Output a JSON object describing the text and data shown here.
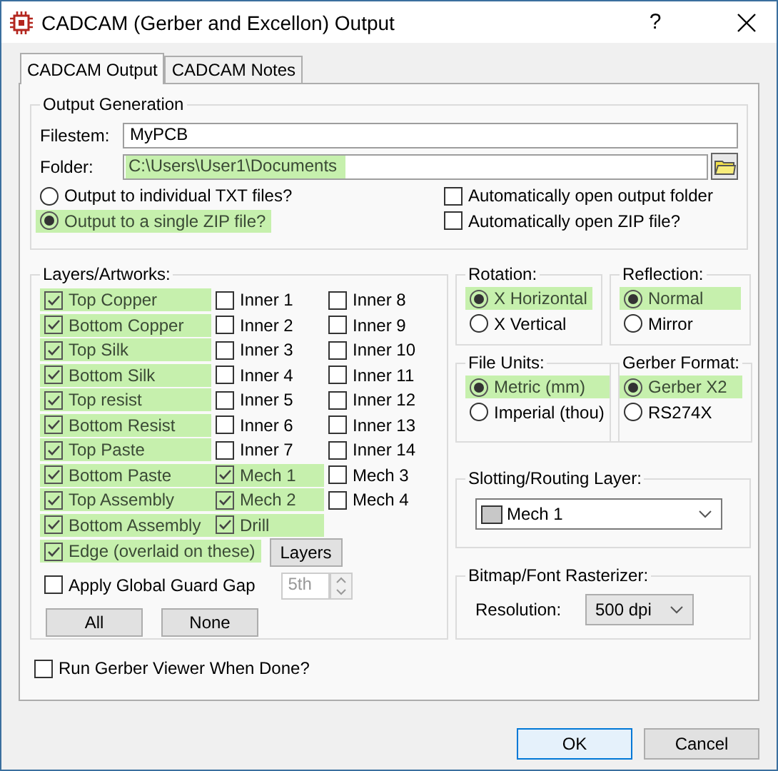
{
  "window": {
    "title": "CADCAM (Gerber and Excellon) Output",
    "help": "?"
  },
  "tabs": [
    {
      "label": "CADCAM Output",
      "selected": true
    },
    {
      "label": "CADCAM Notes",
      "selected": false
    }
  ],
  "output_generation": {
    "title": "Output Generation",
    "filestem": {
      "label": "Filestem:",
      "value": "MyPCB"
    },
    "folder": {
      "label": "Folder:",
      "value": "C:\\Users\\User1\\Documents",
      "highlighted": true
    },
    "output_options": [
      {
        "label": "Output to individual TXT files?",
        "selected": false
      },
      {
        "label": "Output to a single ZIP file?",
        "selected": true
      }
    ],
    "auto_open": [
      {
        "label": "Automatically open output folder",
        "checked": false
      },
      {
        "label": "Automatically open ZIP file?",
        "checked": false
      }
    ]
  },
  "layers": {
    "title": "Layers/Artworks:",
    "columns": [
      [
        {
          "label": "Top Copper",
          "checked": true
        },
        {
          "label": "Bottom Copper",
          "checked": true
        },
        {
          "label": "Top Silk",
          "checked": true
        },
        {
          "label": "Bottom Silk",
          "checked": true
        },
        {
          "label": "Top resist",
          "checked": true
        },
        {
          "label": "Bottom Resist",
          "checked": true
        },
        {
          "label": "Top Paste",
          "checked": true
        },
        {
          "label": "Bottom Paste",
          "checked": true
        },
        {
          "label": "Top Assembly",
          "checked": true
        },
        {
          "label": "Bottom Assembly",
          "checked": true
        }
      ],
      [
        {
          "label": "Inner 1",
          "checked": false
        },
        {
          "label": "Inner 2",
          "checked": false
        },
        {
          "label": "Inner 3",
          "checked": false
        },
        {
          "label": "Inner 4",
          "checked": false
        },
        {
          "label": "Inner 5",
          "checked": false
        },
        {
          "label": "Inner 6",
          "checked": false
        },
        {
          "label": "Inner 7",
          "checked": false
        },
        {
          "label": "Mech 1",
          "checked": true
        },
        {
          "label": "Mech 2",
          "checked": true
        },
        {
          "label": "Drill",
          "checked": true
        }
      ],
      [
        {
          "label": "Inner 8",
          "checked": false
        },
        {
          "label": "Inner 9",
          "checked": false
        },
        {
          "label": "Inner 10",
          "checked": false
        },
        {
          "label": "Inner 11",
          "checked": false
        },
        {
          "label": "Inner 12",
          "checked": false
        },
        {
          "label": "Inner 13",
          "checked": false
        },
        {
          "label": "Inner 14",
          "checked": false
        },
        {
          "label": "Mech 3",
          "checked": false
        },
        {
          "label": "Mech 4",
          "checked": false
        }
      ]
    ],
    "edge": {
      "label": "Edge (overlaid on these)",
      "checked": true
    },
    "layers_button": "Layers",
    "guard_gap": {
      "label": "Apply Global Guard Gap",
      "checked": false,
      "value": "5th",
      "disabled": true
    },
    "buttons": [
      "All",
      "None"
    ]
  },
  "option_groups": [
    {
      "title": "Rotation:",
      "options": [
        {
          "label": "X Horizontal",
          "selected": true
        },
        {
          "label": "X Vertical",
          "selected": false
        }
      ]
    },
    {
      "title": "Reflection:",
      "options": [
        {
          "label": "Normal",
          "selected": true
        },
        {
          "label": "Mirror",
          "selected": false
        }
      ]
    },
    {
      "title": "File Units:",
      "options": [
        {
          "label": "Metric (mm)",
          "selected": true
        },
        {
          "label": "Imperial (thou)",
          "selected": false
        }
      ]
    },
    {
      "title": "Gerber Format:",
      "options": [
        {
          "label": "Gerber X2",
          "selected": true
        },
        {
          "label": "RS274X",
          "selected": false
        }
      ]
    }
  ],
  "slotting": {
    "title": "Slotting/Routing Layer:",
    "value": "Mech 1"
  },
  "rasterizer": {
    "title": "Bitmap/Font Rasterizer:",
    "label": "Resolution:",
    "value": "500 dpi"
  },
  "run_viewer": {
    "label": "Run Gerber Viewer When Done?",
    "checked": false
  },
  "buttons": [
    {
      "label": "OK",
      "default": true
    },
    {
      "label": "Cancel",
      "default": false
    }
  ]
}
